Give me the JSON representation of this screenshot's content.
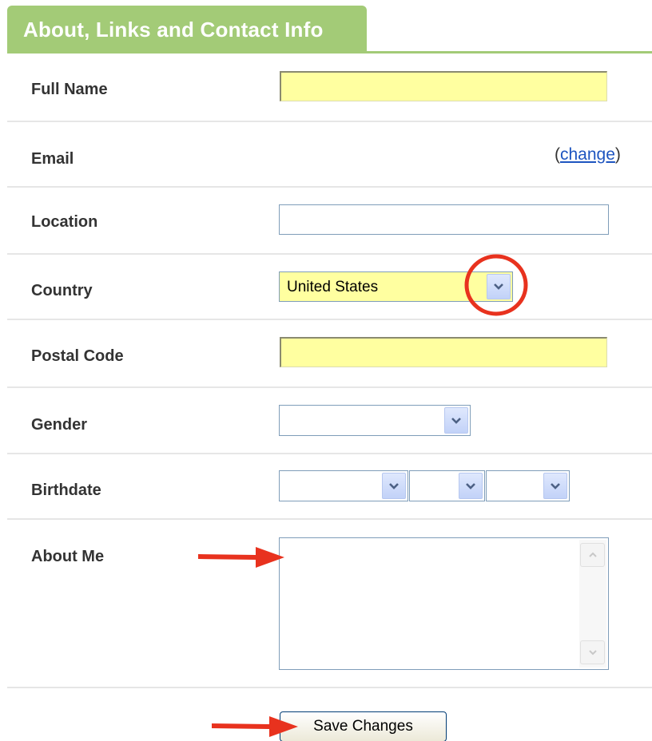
{
  "header": {
    "tab_title": "About, Links and Contact Info"
  },
  "form": {
    "full_name": {
      "label": "Full Name",
      "value": ""
    },
    "email": {
      "label": "Email",
      "change_open": "(",
      "change_link": "change",
      "change_close": ")"
    },
    "location": {
      "label": "Location",
      "value": ""
    },
    "country": {
      "label": "Country",
      "selected": "United States"
    },
    "postal_code": {
      "label": "Postal Code",
      "value": ""
    },
    "gender": {
      "label": "Gender",
      "selected": ""
    },
    "birthdate": {
      "label": "Birthdate",
      "month": "",
      "day": "",
      "year": ""
    },
    "about_me": {
      "label": "About Me",
      "value": ""
    },
    "save_label": "Save Changes"
  },
  "colors": {
    "tab_green": "#a3cb77",
    "highlight_yellow": "#ffffa0",
    "annotation_red": "#e8321e",
    "link_blue": "#1e55c0"
  },
  "icons": {
    "dropdown": "chevron-down-icon",
    "scroll_up": "scroll-up-arrow-icon",
    "scroll_down": "scroll-down-arrow-icon",
    "annotation_arrow": "red-arrow-icon",
    "annotation_circle": "red-circle-annotation"
  }
}
